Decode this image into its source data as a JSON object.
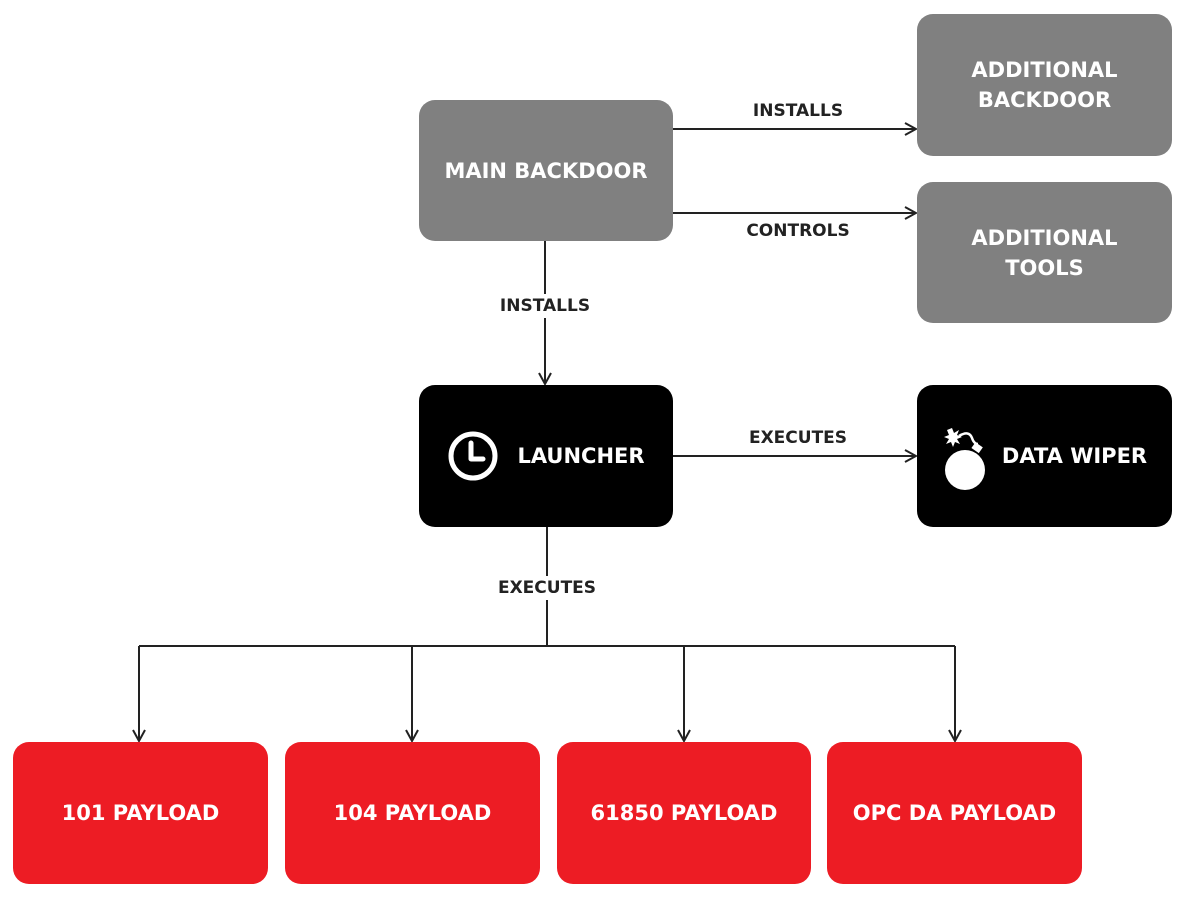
{
  "nodes": {
    "main_backdoor": "MAIN BACKDOOR",
    "additional_backdoor": "ADDITIONAL BACKDOOR",
    "additional_tools": "ADDITIONAL TOOLS",
    "launcher": "LAUNCHER",
    "data_wiper": "DATA WIPER",
    "payload_101": "101 PAYLOAD",
    "payload_104": "104 PAYLOAD",
    "payload_61850": "61850 PAYLOAD",
    "payload_opc": "OPC DA PAYLOAD"
  },
  "edges": {
    "main_to_additional_backdoor": "INSTALLS",
    "main_to_additional_tools": "CONTROLS",
    "main_to_launcher": "INSTALLS",
    "launcher_to_wiper": "EXECUTES",
    "launcher_to_payloads": "EXECUTES"
  },
  "icons": {
    "launcher": "clock-icon",
    "data_wiper": "bomb-icon"
  },
  "colors": {
    "gray": "#808080",
    "black": "#000000",
    "red": "#ed1c24"
  }
}
